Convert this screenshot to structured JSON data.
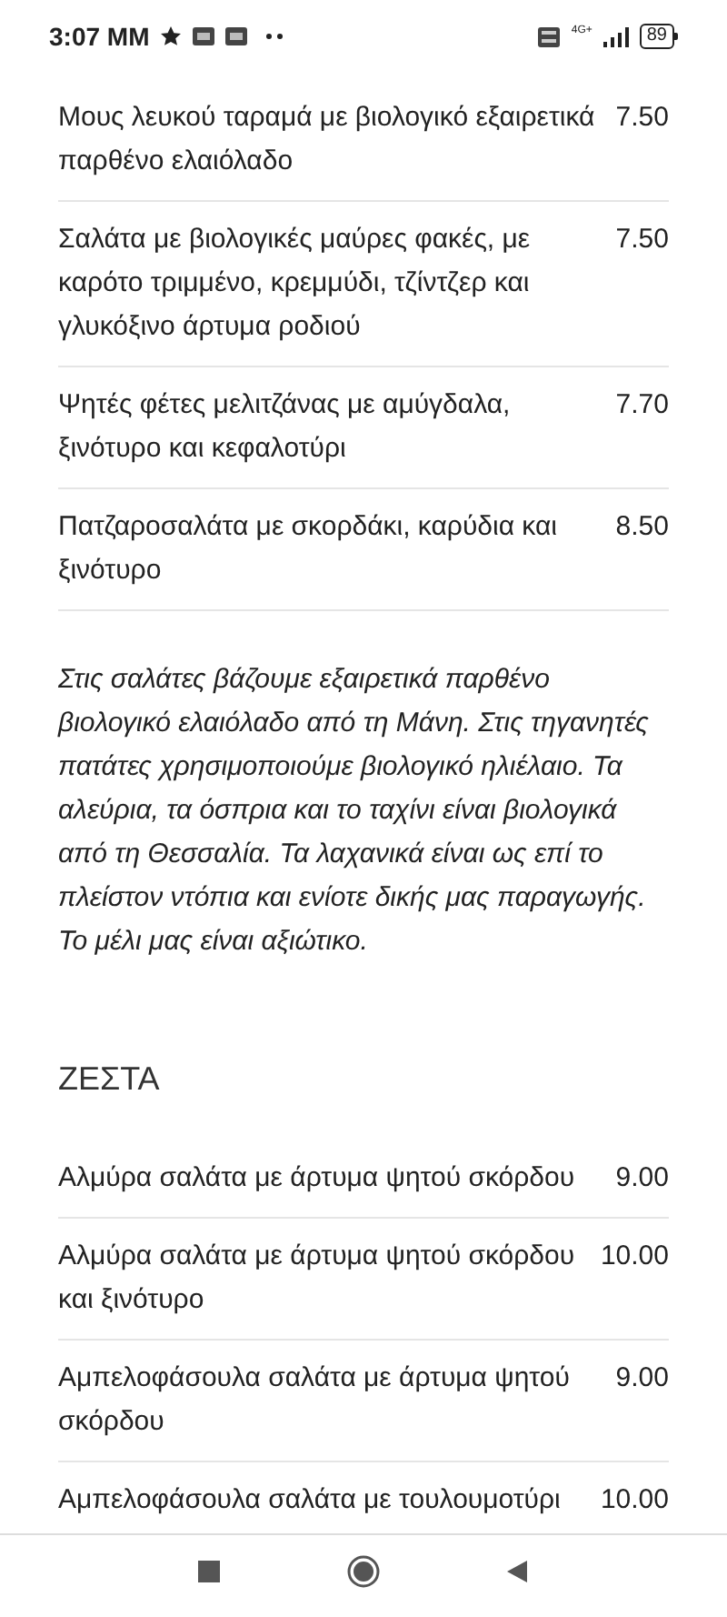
{
  "status_bar": {
    "time": "3:07 MM",
    "network": "4G+",
    "battery": "89"
  },
  "sections": [
    {
      "items": [
        {
          "name": "Μους λευκού ταραμά με βιολογικό εξαιρετικά παρθένο ελαιόλαδο",
          "price": "7.50"
        },
        {
          "name": "Σαλάτα με βιολογικές μαύρες φακές, με καρότο τριμμένο, κρεμμύδι, τζίντζερ και γλυκόξινο άρτυμα ροδιού",
          "price": "7.50"
        },
        {
          "name": "Ψητές φέτες μελιτζάνας με αμύγδαλα, ξινότυρο και κεφαλοτύρι",
          "price": "7.70"
        },
        {
          "name": "Πατζαροσαλάτα με σκορδάκι, καρύδια και ξινότυρο",
          "price": "8.50"
        }
      ],
      "note": "Στις σαλάτες βάζουμε εξαιρετικά παρθένο βιολογικό ελαιόλαδο από τη Μάνη. Στις τηγανητές πατάτες χρησιμοποιούμε βιολογικό ηλιέλαιο. Τα αλεύρια, τα όσπρια και το ταχίνι είναι βιολογικά από τη Θεσσαλία. Τα λαχανικά είναι ως επί το πλείστον ντόπια και ενίοτε δικής μας παραγωγής. Το μέλι μας είναι αξιώτικο."
    },
    {
      "heading": "ΖΕΣΤΑ",
      "items": [
        {
          "name": "Αλμύρα σαλάτα με άρτυμα ψητού σκόρδου",
          "price": "9.00"
        },
        {
          "name": "Αλμύρα σαλάτα με άρτυμα ψητού σκόρδου και ξινότυρο",
          "price": "10.00"
        },
        {
          "name": "Αμπελοφάσουλα σαλάτα με άρτυμα ψητού σκόρδου",
          "price": "9.00"
        },
        {
          "name": "Αμπελοφάσουλα σαλάτα με τουλουμοτύρι",
          "price": "10.00"
        }
      ]
    }
  ]
}
